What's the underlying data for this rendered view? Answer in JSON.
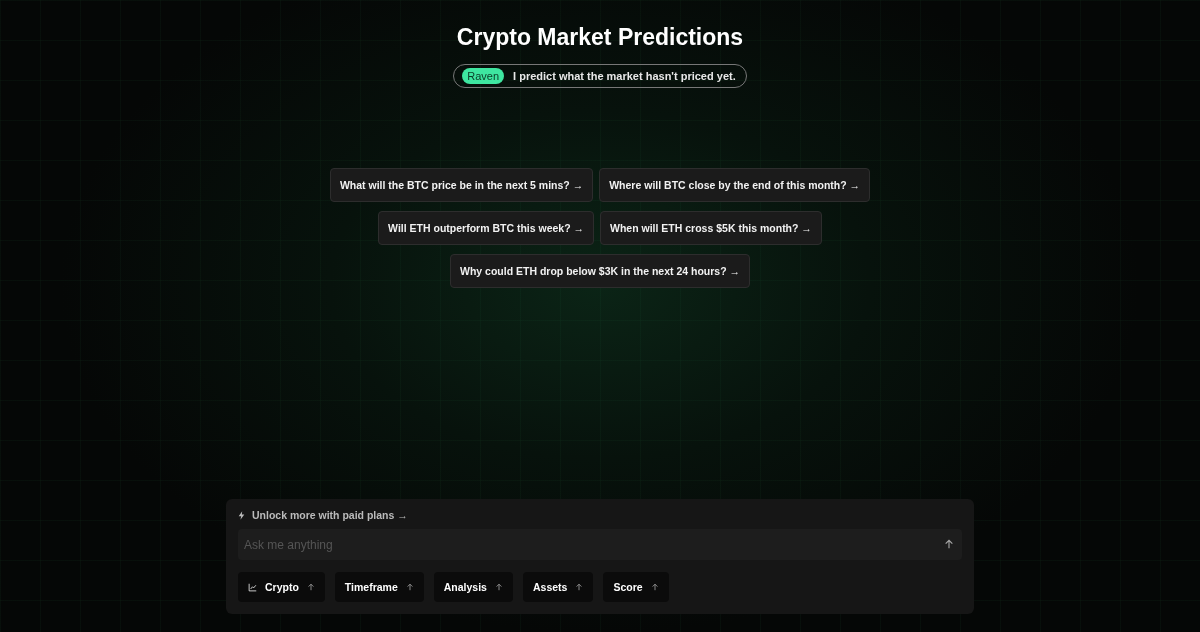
{
  "title": "Crypto Market Predictions",
  "tagline": {
    "badge": "Raven",
    "text": "I predict what the market hasn't priced yet."
  },
  "suggestions": [
    [
      "What will the BTC price be in the next 5 mins? →",
      "Where will BTC close by the end of this month? →"
    ],
    [
      "Will ETH outperform BTC this week? →",
      "When will ETH cross $5K this month? →"
    ],
    [
      "Why could ETH drop below $3K in the next 24 hours? →"
    ]
  ],
  "composer": {
    "upgrade": "Unlock more with paid plans →",
    "placeholder": "Ask me anything",
    "chips": [
      {
        "label": "Crypto",
        "kind": "chart"
      },
      {
        "label": "Timeframe",
        "kind": "plain"
      },
      {
        "label": "Analysis",
        "kind": "plain"
      },
      {
        "label": "Assets",
        "kind": "plain"
      },
      {
        "label": "Score",
        "kind": "plain"
      }
    ]
  }
}
